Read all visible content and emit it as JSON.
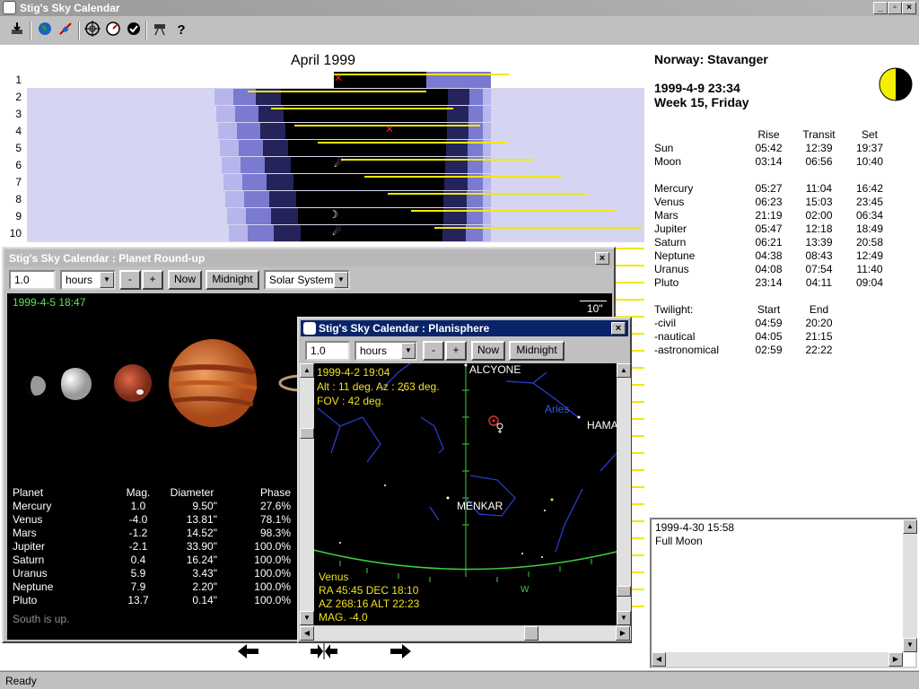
{
  "window": {
    "title": "Stig's Sky Calendar"
  },
  "toolbar": {
    "icons": [
      "print-icon",
      "globe-icon",
      "satellite-icon",
      "target-icon",
      "dial-icon",
      "clock-icon",
      "telescope-icon",
      "help-icon"
    ]
  },
  "calendar": {
    "month_title": "April 1999",
    "days": [
      "1",
      "2",
      "3",
      "4",
      "5",
      "6",
      "7",
      "8",
      "9",
      "10"
    ]
  },
  "location": {
    "name": "Norway: Stavanger",
    "datetime": "1999-4-9 23:34",
    "week": "Week 15, Friday",
    "moon_phase_icon": "half-moon-icon"
  },
  "rise_set": {
    "headers": [
      "Rise",
      "Transit",
      "Set"
    ],
    "rows": [
      {
        "name": "Sun",
        "rise": "05:42",
        "transit": "12:39",
        "set": "19:37"
      },
      {
        "name": "Moon",
        "rise": "03:14",
        "transit": "06:56",
        "set": "10:40"
      }
    ],
    "planets": [
      {
        "name": "Mercury",
        "rise": "05:27",
        "transit": "11:04",
        "set": "16:42"
      },
      {
        "name": "Venus",
        "rise": "06:23",
        "transit": "15:03",
        "set": "23:45"
      },
      {
        "name": "Mars",
        "rise": "21:19",
        "transit": "02:00",
        "set": "06:34"
      },
      {
        "name": "Jupiter",
        "rise": "05:47",
        "transit": "12:18",
        "set": "18:49"
      },
      {
        "name": "Saturn",
        "rise": "06:21",
        "transit": "13:39",
        "set": "20:58"
      },
      {
        "name": "Neptune",
        "rise": "04:38",
        "transit": "08:43",
        "set": "12:49"
      },
      {
        "name": "Uranus",
        "rise": "04:08",
        "transit": "07:54",
        "set": "11:40"
      },
      {
        "name": "Pluto",
        "rise": "23:14",
        "transit": "04:11",
        "set": "09:04"
      }
    ]
  },
  "twilight": {
    "label": "Twilight:",
    "headers": [
      "Start",
      "End"
    ],
    "rows": [
      {
        "name": "-civil",
        "start": "04:59",
        "end": "20:20"
      },
      {
        "name": "-nautical",
        "start": "04:05",
        "end": "21:15"
      },
      {
        "name": "-astronomical",
        "start": "02:59",
        "end": "22:22"
      }
    ]
  },
  "events": {
    "date": "1999-4-30 15:58",
    "text": "Full Moon"
  },
  "status": "Ready",
  "roundup": {
    "title": "Stig's Sky Calendar : Planet Round-up",
    "step_value": "1.0",
    "unit": "hours",
    "minus": "-",
    "plus": "+",
    "now": "Now",
    "midnight": "Midnight",
    "mode": "Solar System",
    "datetime": "1999-4-5 18:47",
    "scale": "10\"",
    "headers": [
      "Planet",
      "Mag.",
      "Diameter",
      "Phase"
    ],
    "rows": [
      {
        "name": "Mercury",
        "mag": "1.0",
        "diam": "9.50\"",
        "phase": "27.6%"
      },
      {
        "name": "Venus",
        "mag": "-4.0",
        "diam": "13.81\"",
        "phase": "78.1%"
      },
      {
        "name": "Mars",
        "mag": "-1.2",
        "diam": "14.52\"",
        "phase": "98.3%"
      },
      {
        "name": "Jupiter",
        "mag": "-2.1",
        "diam": "33.90\"",
        "phase": "100.0%"
      },
      {
        "name": "Saturn",
        "mag": "0.4",
        "diam": "16.24\"",
        "phase": "100.0%"
      },
      {
        "name": "Uranus",
        "mag": "5.9",
        "diam": "3.43\"",
        "phase": "100.0%"
      },
      {
        "name": "Neptune",
        "mag": "7.9",
        "diam": "2.20\"",
        "phase": "100.0%"
      },
      {
        "name": "Pluto",
        "mag": "13.7",
        "diam": "0.14\"",
        "phase": "100.0%"
      }
    ],
    "note": "South is up."
  },
  "planisphere": {
    "title": "Stig's Sky Calendar : Planisphere",
    "step_value": "1.0",
    "unit": "hours",
    "minus": "-",
    "plus": "+",
    "now": "Now",
    "midnight": "Midnight",
    "datetime": "1999-4-2 19:04",
    "altaz": "Alt : 11 deg.  Az : 263 deg.",
    "fov": "FOV : 42 deg.",
    "labels": {
      "alcyone": "ALCYONE",
      "aries": "Aries",
      "hamal": "HAMAL",
      "menkar": "MENKAR",
      "west": "W"
    },
    "object": "Venus",
    "ra_dec": "RA 45:45   DEC 18:10",
    "az_alt": "AZ 268:16   ALT 22:23",
    "mag": "MAG.  -4.0"
  }
}
